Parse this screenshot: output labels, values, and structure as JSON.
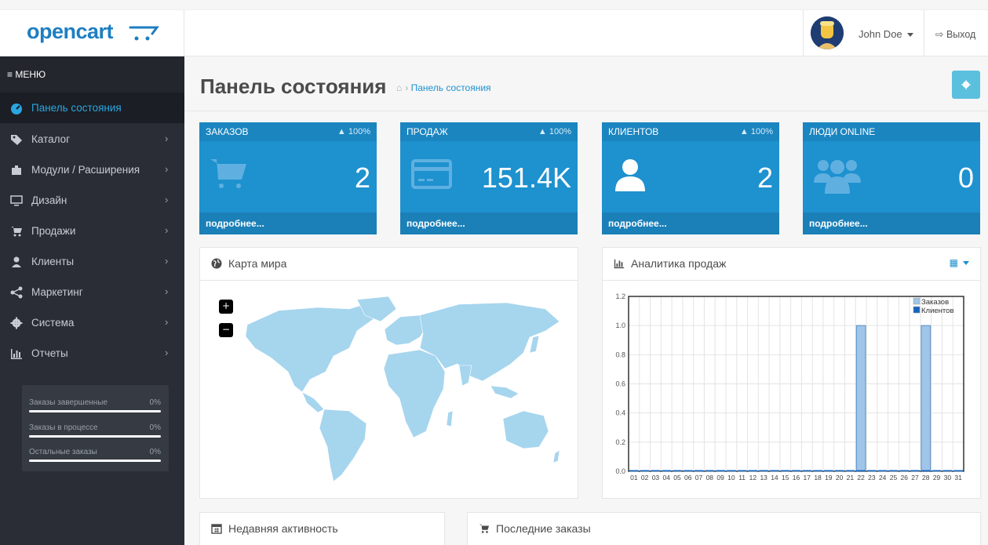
{
  "header": {
    "logo_text": "opencart",
    "user_name": "John Doe",
    "logout_label": "Выход"
  },
  "sidebar": {
    "menu_label": "МЕНЮ",
    "items": [
      {
        "label": "Панель состояния",
        "icon": "dashboard-icon"
      },
      {
        "label": "Каталог",
        "icon": "tag-icon"
      },
      {
        "label": "Модули / Расширения",
        "icon": "puzzle-icon"
      },
      {
        "label": "Дизайн",
        "icon": "desktop-icon"
      },
      {
        "label": "Продажи",
        "icon": "cart-icon"
      },
      {
        "label": "Клиенты",
        "icon": "user-icon"
      },
      {
        "label": "Маркетинг",
        "icon": "share-icon"
      },
      {
        "label": "Система",
        "icon": "cog-icon"
      },
      {
        "label": "Отчеты",
        "icon": "bar-chart-icon"
      }
    ],
    "stats": [
      {
        "label": "Заказы завершенные",
        "percent": "0%"
      },
      {
        "label": "Заказы в процессе",
        "percent": "0%"
      },
      {
        "label": "Остальные заказы",
        "percent": "0%"
      }
    ]
  },
  "page": {
    "title": "Панель состояния",
    "breadcrumb": "Панель состояния"
  },
  "tiles": [
    {
      "title": "ЗАКАЗОВ",
      "delta": "100%",
      "value": "2",
      "footer": "подробнее...",
      "icon": "cart-icon"
    },
    {
      "title": "ПРОДАЖ",
      "delta": "100%",
      "value": "151.4K",
      "footer": "подробнее...",
      "icon": "credit-card-icon"
    },
    {
      "title": "КЛИЕНТОВ",
      "delta": "100%",
      "value": "2",
      "footer": "подробнее...",
      "icon": "user-icon"
    },
    {
      "title": "ЛЮДИ ONLINE",
      "delta": "",
      "value": "0",
      "footer": "подробнее...",
      "icon": "users-icon"
    }
  ],
  "map_panel": {
    "title": "Карта мира",
    "zoom_in": "+",
    "zoom_out": "−"
  },
  "chart_panel": {
    "title": "Аналитика продаж"
  },
  "activity_panel": {
    "title": "Недавняя активность"
  },
  "orders_panel": {
    "title": "Последние заказы"
  },
  "colors": {
    "accent": "#1e91cf",
    "sidebar": "#2a2d35",
    "bar_orders": "#9fc5e8",
    "bar_customers": "#1565c0"
  },
  "chart_data": {
    "type": "bar",
    "categories": [
      "01",
      "02",
      "03",
      "04",
      "05",
      "06",
      "07",
      "08",
      "09",
      "10",
      "11",
      "12",
      "13",
      "14",
      "15",
      "16",
      "17",
      "18",
      "19",
      "20",
      "21",
      "22",
      "23",
      "24",
      "25",
      "26",
      "27",
      "28",
      "29",
      "30",
      "31"
    ],
    "series": [
      {
        "name": "Заказов",
        "values": [
          0,
          0,
          0,
          0,
          0,
          0,
          0,
          0,
          0,
          0,
          0,
          0,
          0,
          0,
          0,
          0,
          0,
          0,
          0,
          0,
          0,
          1,
          0,
          0,
          0,
          0,
          0,
          1,
          0,
          0,
          0
        ]
      },
      {
        "name": "Клиентов",
        "values": [
          0,
          0,
          0,
          0,
          0,
          0,
          0,
          0,
          0,
          0,
          0,
          0,
          0,
          0,
          0,
          0,
          0,
          0,
          0,
          0,
          0,
          0,
          0,
          0,
          0,
          0,
          0,
          0,
          0,
          0,
          0
        ]
      }
    ],
    "yticks": [
      "0.0",
      "0.2",
      "0.4",
      "0.6",
      "0.8",
      "1.0",
      "1.2"
    ],
    "ylim": [
      0,
      1.2
    ],
    "grid": true,
    "legend": "top-right",
    "title": "",
    "xlabel": "",
    "ylabel": ""
  }
}
